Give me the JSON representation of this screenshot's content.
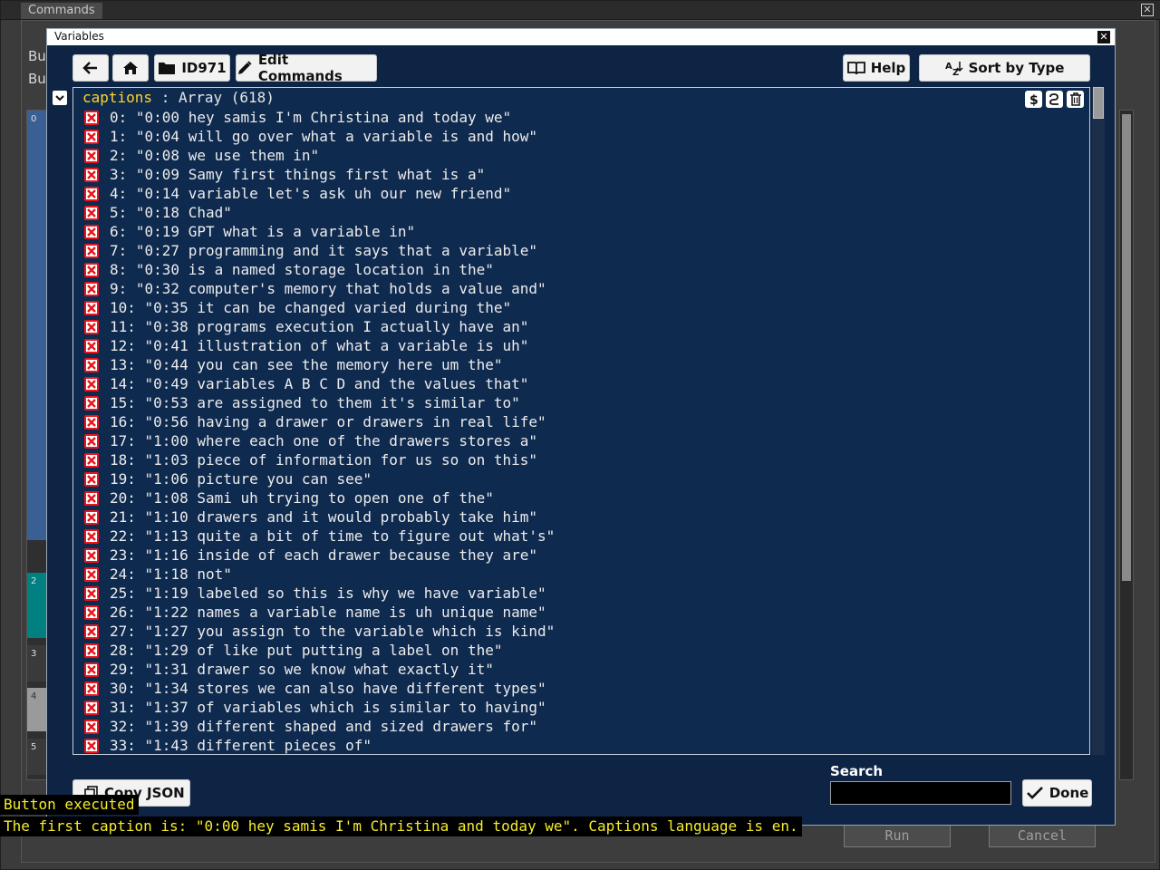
{
  "background": {
    "window_title": "Commands",
    "labels": [
      "Bu",
      "Bu"
    ],
    "line_numbers": [
      "0",
      "2",
      "3",
      "4",
      "5"
    ],
    "buttons": {
      "run": "Run",
      "cancel": "Cancel"
    }
  },
  "dialog": {
    "title": "Variables",
    "toolbar": {
      "id_label": "ID971",
      "edit_label": "Edit Commands",
      "help_label": "Help",
      "sort_label": "Sort by Type"
    },
    "variable": {
      "name": "captions",
      "separator": " : ",
      "type": "Array (618)"
    },
    "items": [
      "0: \"0:00 hey samis I'm Christina and today we\"",
      "1: \"0:04 will go over what a variable is and how\"",
      "2: \"0:08 we use them in\"",
      "3: \"0:09 Samy first things first what is a\"",
      "4: \"0:14 variable let's ask uh our new friend\"",
      "5: \"0:18 Chad\"",
      "6: \"0:19 GPT what is a variable in\"",
      "7: \"0:27 programming and it says that a variable\"",
      "8: \"0:30 is a named storage location in the\"",
      "9: \"0:32 computer's memory that holds a value and\"",
      "10: \"0:35 it can be changed varied during the\"",
      "11: \"0:38 programs execution I actually have an\"",
      "12: \"0:41 illustration of what a variable is uh\"",
      "13: \"0:44 you can see the memory here um the\"",
      "14: \"0:49 variables A B C D and the values that\"",
      "15: \"0:53 are assigned to them it's similar to\"",
      "16: \"0:56 having a drawer or drawers in real life\"",
      "17: \"1:00 where each one of the drawers stores a\"",
      "18: \"1:03 piece of information for us so on this\"",
      "19: \"1:06 picture you can see\"",
      "20: \"1:08 Sami uh trying to open one of the\"",
      "21: \"1:10 drawers and it would probably take him\"",
      "22: \"1:13 quite a bit of time to figure out what's\"",
      "23: \"1:16 inside of each drawer because they are\"",
      "24: \"1:18 not\"",
      "25: \"1:19 labeled so this is why we have variable\"",
      "26: \"1:22 names a variable name is uh unique name\"",
      "27: \"1:27 you assign to the variable which is kind\"",
      "28: \"1:29 of like put putting a label on the\"",
      "29: \"1:31 drawer so we know what exactly it\"",
      "30: \"1:34 stores we can also have different types\"",
      "31: \"1:37 of variables which is similar to having\"",
      "32: \"1:39 different shaped and sized drawers for\"",
      "33: \"1:43 different pieces of\""
    ],
    "search": {
      "label": "Search",
      "value": ""
    },
    "done_label": "Done",
    "copy_label": "Copy JSON"
  },
  "console": {
    "line1": "Button executed",
    "line2": "The first caption is: \"0:00 hey samis I'm Christina and today we\". Captions language is en."
  }
}
